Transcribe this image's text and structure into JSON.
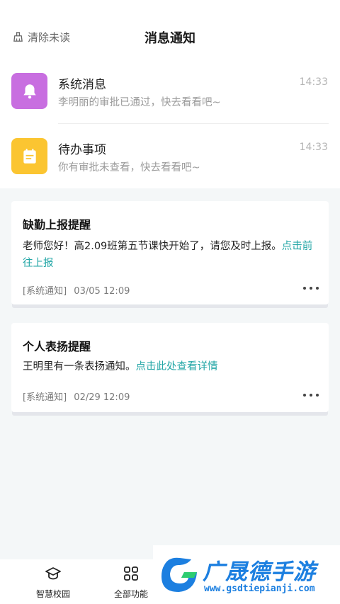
{
  "header": {
    "clear_label": "清除未读",
    "title": "消息通知"
  },
  "messages": [
    {
      "title": "系统消息",
      "subtitle": "李明丽的审批已通过，快去看看吧~",
      "time": "14:33",
      "icon": "bell-icon",
      "color": "#c86ee0"
    },
    {
      "title": "待办事项",
      "subtitle": "你有审批未查看，快去看看吧~",
      "time": "14:33",
      "icon": "calendar-icon",
      "color": "#fbc531"
    }
  ],
  "cards": [
    {
      "title": "缺勤上报提醒",
      "text": "老师您好！高2.09班第五节课快开始了，请您及时上报。",
      "link": "点击前往上报",
      "source": "[系统通知]",
      "date": "03/05 12:09"
    },
    {
      "title": "个人表扬提醒",
      "text": "王明里有一条表扬通知。",
      "link": "点击此处查看详情",
      "source": "[系统通知]",
      "date": "02/29 12:09"
    }
  ],
  "tabbar": {
    "items": [
      {
        "label": "智慧校园",
        "icon": "graduation-cap-icon"
      },
      {
        "label": "全部功能",
        "icon": "grid-icon"
      }
    ]
  },
  "watermark": {
    "brand": "广晟德手游",
    "url": "www.gsdtiepianji.com"
  },
  "colors": {
    "accent_link": "#22a6a6",
    "content_bg": "#f4f7f8"
  }
}
